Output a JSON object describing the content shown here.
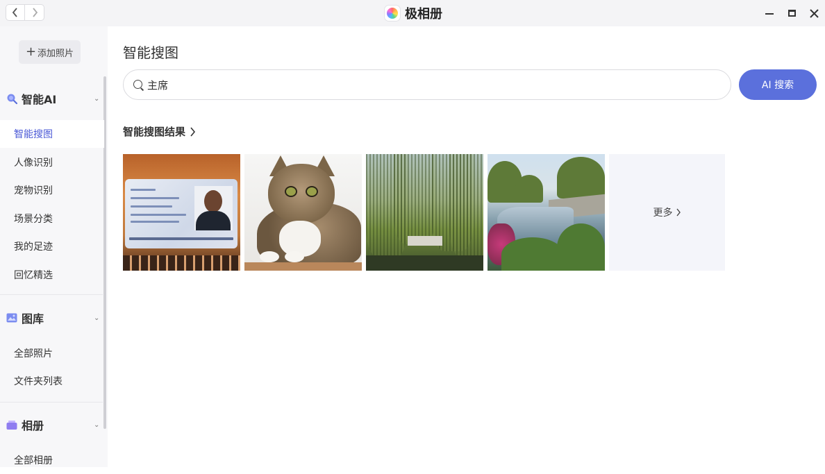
{
  "window": {
    "title": "极相册",
    "back_icon": "chevron-left-icon",
    "forward_icon": "chevron-right-icon"
  },
  "sidebar": {
    "add_photo_label": "添加照片",
    "sections": [
      {
        "title": "智能AI",
        "icon": "magnifier-ai-icon",
        "items": [
          "智能搜图",
          "人像识别",
          "宠物识别",
          "场景分类",
          "我的足迹",
          "回忆精选"
        ]
      },
      {
        "title": "图库",
        "icon": "image-gallery-icon",
        "items": [
          "全部照片",
          "文件夹列表"
        ]
      },
      {
        "title": "相册",
        "icon": "album-icon",
        "items": [
          "全部相册"
        ]
      }
    ],
    "active_item": "智能搜图"
  },
  "main": {
    "page_title": "智能搜图",
    "search": {
      "value": "主席",
      "button_label": "AI 搜索"
    },
    "results_heading": "智能搜图结果",
    "results": [
      {
        "kind": "photo",
        "subject": "id-card"
      },
      {
        "kind": "photo",
        "subject": "cat"
      },
      {
        "kind": "photo",
        "subject": "willow-trees"
      },
      {
        "kind": "photo",
        "subject": "lake-park"
      }
    ],
    "more_label": "更多"
  },
  "colors": {
    "accent": "#5b70dc",
    "active_text": "#4a58d6",
    "sidebar_bg": "#f7f7f9",
    "titlebar_bg": "#f4f4f6"
  }
}
